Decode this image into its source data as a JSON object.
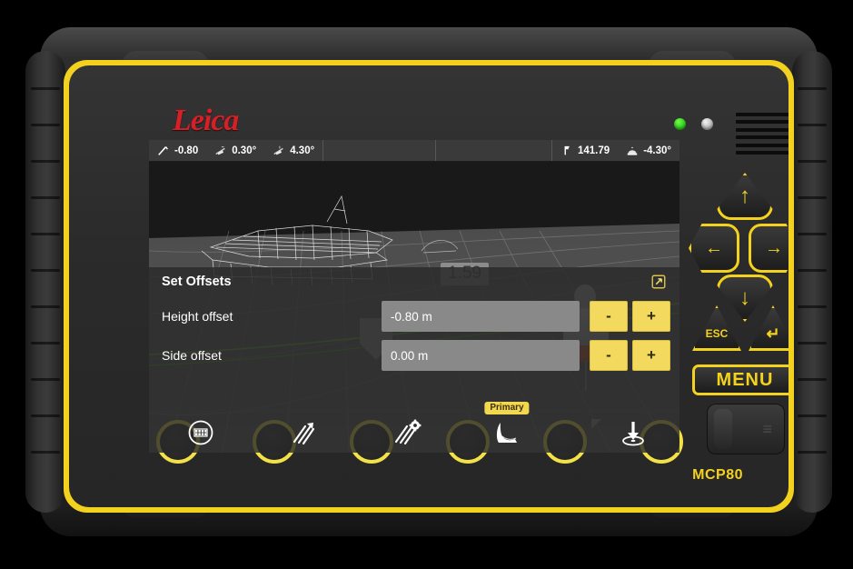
{
  "device": {
    "brand": "Leica",
    "model": "MCP80",
    "leds": [
      {
        "name": "power-led",
        "color": "#2ecc0a",
        "state": "on"
      },
      {
        "name": "status-led",
        "color": "#e8e8e8",
        "state": "off"
      }
    ]
  },
  "statusbar": {
    "left_items": [
      {
        "icon": "blade-slope-icon",
        "value": "-0.80"
      },
      {
        "icon": "cross-slope-icon",
        "value": "0.30°"
      },
      {
        "icon": "mainfall-slope-icon",
        "value": "4.30°"
      }
    ],
    "right_items": [
      {
        "icon": "elevation-icon",
        "value": "141.79"
      },
      {
        "icon": "bucket-angle-icon",
        "value": "-4.30°"
      }
    ]
  },
  "viewport": {
    "elevation_callout": "1.59",
    "reference_line_color": "#5fd321",
    "bucket_edge_color": "#f2571c"
  },
  "panel": {
    "title": "Set Offsets",
    "expand_icon": "external-link-icon",
    "rows": [
      {
        "label": "Height offset",
        "value": "-0.80 m",
        "decrement_label": "-",
        "increment_label": "+"
      },
      {
        "label": "Side offset",
        "value": "0.00 m",
        "decrement_label": "-",
        "increment_label": "+"
      }
    ]
  },
  "toolbar": {
    "items": [
      {
        "name": "app-menu-icon",
        "badge": null
      },
      {
        "name": "slope-direction-icon",
        "badge": null
      },
      {
        "name": "slope-settings-icon",
        "badge": null
      },
      {
        "name": "bucket-primary-icon",
        "badge": "Primary"
      },
      {
        "name": "target-elevation-icon",
        "badge": null
      }
    ]
  },
  "keypad": {
    "up_label": "↑",
    "left_label": "←",
    "right_label": "→",
    "down_label": "↓",
    "esc_label": "ESC",
    "enter_label": "↵",
    "menu_label": "MENU"
  },
  "softkeys": {
    "count": 6,
    "labels": [
      "",
      "",
      "",
      "",
      "",
      ""
    ]
  },
  "colors": {
    "brand_red": "#d81f26",
    "frame_yellow": "#f3d21f",
    "button_yellow": "#f3da5f",
    "screen_bg": "#2b2b2b",
    "field_grey": "#898989"
  }
}
